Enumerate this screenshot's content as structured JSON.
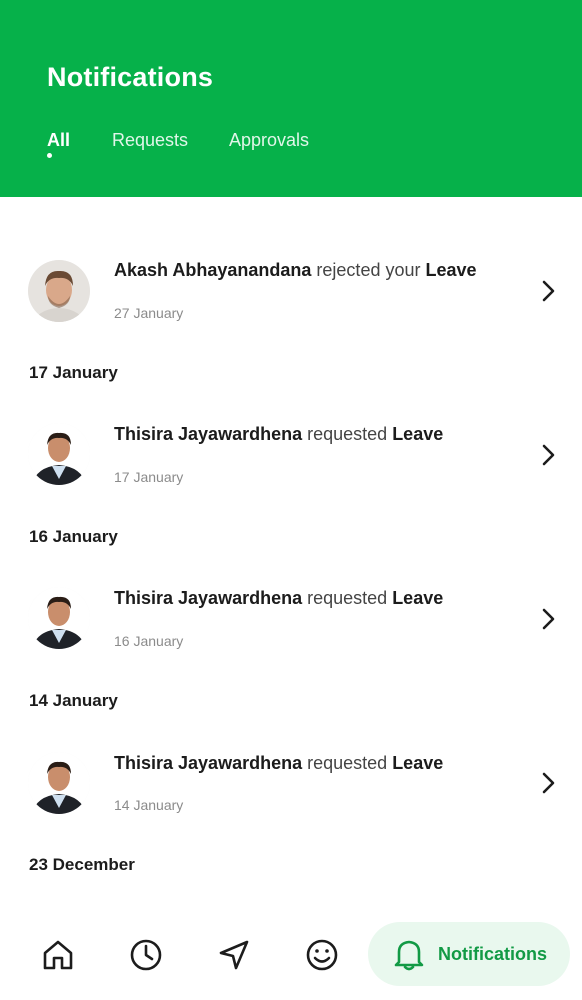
{
  "header": {
    "title": "Notifications",
    "tabs": [
      {
        "label": "All",
        "active": true
      },
      {
        "label": "Requests",
        "active": false
      },
      {
        "label": "Approvals",
        "active": false
      }
    ],
    "brand_color": "#06b14a"
  },
  "notifications": [
    {
      "actor": "Akash Abhayanandana",
      "action": "rejected your",
      "subject": "Leave",
      "date": "27 January",
      "avatar": "akash-avatar"
    },
    {
      "section": "17 January",
      "actor": "Thisira Jayawardhena",
      "action": "requested",
      "subject": "Leave",
      "date": "17 January",
      "avatar": "thisira-avatar"
    },
    {
      "section": "16 January",
      "actor": "Thisira Jayawardhena",
      "action": "requested",
      "subject": "Leave",
      "date": "16 January",
      "avatar": "thisira-avatar"
    },
    {
      "section": "14 January",
      "actor": "Thisira Jayawardhena",
      "action": "requested",
      "subject": "Leave",
      "date": "14 January",
      "avatar": "thisira-avatar"
    }
  ],
  "trailing_section": "23 December",
  "bottom_nav": {
    "items": [
      {
        "icon": "home-icon"
      },
      {
        "icon": "clock-icon"
      },
      {
        "icon": "navigation-icon"
      },
      {
        "icon": "smiley-icon"
      }
    ],
    "active": {
      "icon": "bell-icon",
      "label": "Notifications",
      "color": "#129a45",
      "bg": "#e9f8ee"
    }
  }
}
